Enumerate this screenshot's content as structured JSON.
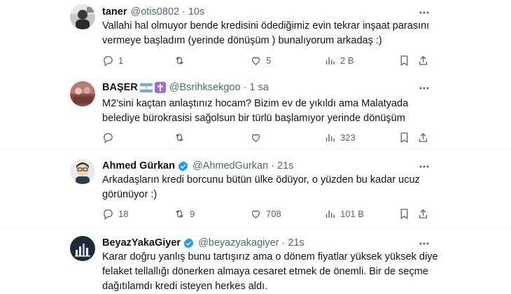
{
  "tweets": [
    {
      "name": "taner",
      "handle": "@otis0802",
      "time": "10s",
      "body": "Vallahi hal olmuyor bende kredisini ödediğimiz evin tekrar inşaat parasını vermeye başladım (yerinde dönüşüm ) bunalıyorum arkadaş :)",
      "replies": "1",
      "retweets": "",
      "likes": "5",
      "views": "2 B"
    },
    {
      "name": "BAŞER",
      "name_emoji": [
        "flag-argentina",
        "latin-cross"
      ],
      "handle": "@Bsrihksekgoo",
      "time": "1 sa",
      "body": "M2'sini kaçtan anlaştınız hocam? Bizim ev de yıkıldı ama Malatyada belediye bürokrasisi sağolsun bir türlü başlamıyor yerinde dönüşüm",
      "replies": "",
      "retweets": "",
      "likes": "",
      "views": "323"
    },
    {
      "name": "Ahmed Gürkan",
      "verified": true,
      "handle": "@AhmedGurkan",
      "time": "21s",
      "body": "Arkadaşların kredi borcunu bütün ülke ödüyor, o yüzden bu kadar ucuz görünüyor :)",
      "replies": "18",
      "retweets": "9",
      "likes": "708",
      "views": "101 B"
    },
    {
      "name": "BeyazYakaGiyer",
      "verified": true,
      "handle": "@beyazyakagiyer",
      "time": "21s",
      "body": "Karar doğru yanlış bunu tartışırız ama o dönem fiyatlar yüksek yüksek diye felaket tellallığı dönerken almaya cesaret etmek de önemli. Bir de seçme dağıtılamdı kredi isteyen herkes aldı.",
      "replies": "",
      "retweets": "",
      "likes": "",
      "views": ""
    }
  ],
  "icons": {
    "reply": "reply-icon",
    "retweet": "retweet-icon",
    "like": "heart-icon",
    "views": "views-icon",
    "bookmark": "bookmark-icon",
    "share": "share-icon",
    "more": "more-options-icon",
    "verified": "verified-badge-icon"
  },
  "colors": {
    "text": "#0f1419",
    "secondary": "#536471",
    "verified": "#1d9bf0",
    "separator": "#eff3f4"
  }
}
